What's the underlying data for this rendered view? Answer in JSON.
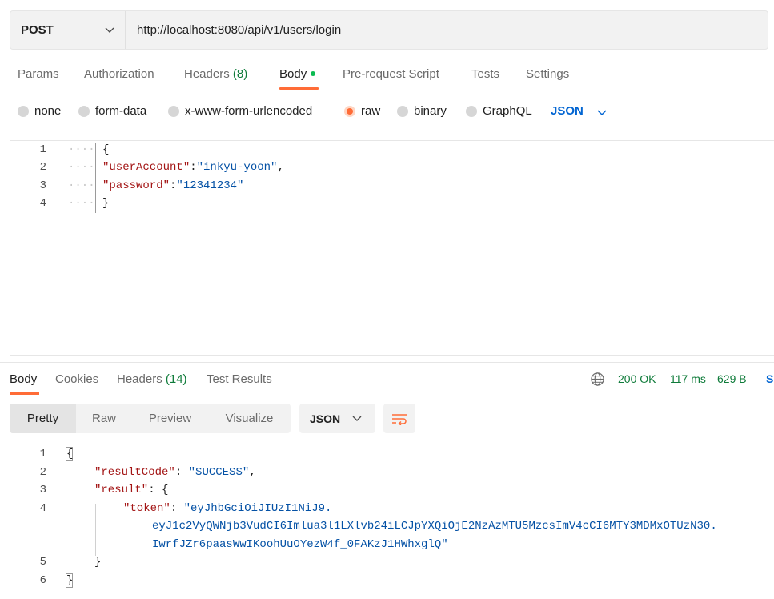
{
  "request": {
    "method": "POST",
    "url": "http://localhost:8080/api/v1/users/login"
  },
  "request_tabs": {
    "params": "Params",
    "authorization": "Authorization",
    "headers": "Headers",
    "headers_count": "(8)",
    "body": "Body",
    "prerequest": "Pre-request Script",
    "tests": "Tests",
    "settings": "Settings",
    "active": "Body"
  },
  "body_modes": {
    "none": "none",
    "form_data": "form-data",
    "urlencoded": "x-www-form-urlencoded",
    "raw": "raw",
    "binary": "binary",
    "graphql": "GraphQL",
    "selected": "raw",
    "language": "JSON"
  },
  "request_body": {
    "line_numbers": [
      "1",
      "2",
      "3",
      "4"
    ],
    "open_brace": "{",
    "close_brace": "}",
    "k1": "\"userAccount\"",
    "v1": "\"inkyu-yoon\"",
    "k2": "\"password\"",
    "v2": "\"12341234\"",
    "colon": ":",
    "comma": ","
  },
  "response_tabs": {
    "body": "Body",
    "cookies": "Cookies",
    "headers": "Headers",
    "headers_count": "(14)",
    "test_results": "Test Results",
    "active": "Body"
  },
  "response_meta": {
    "status": "200 OK",
    "time": "117 ms",
    "size": "629 B",
    "save_truncated": "S"
  },
  "response_toolbar": {
    "views": [
      "Pretty",
      "Raw",
      "Preview",
      "Visualize"
    ],
    "active_view": "Pretty",
    "format": "JSON"
  },
  "response_body": {
    "line_numbers": [
      "1",
      "2",
      "3",
      "4",
      "5",
      "6"
    ],
    "open_brace": "{",
    "close_brace": "}",
    "k_resultCode": "\"resultCode\"",
    "v_resultCode": "\"SUCCESS\"",
    "k_result": "\"result\"",
    "k_token": "\"token\"",
    "token_line1": "\"eyJhbGciOiJIUzI1NiJ9.",
    "token_line2": "eyJ1c2VyQWNjb3VudCI6Imlua3l1LXlvb24iLCJpYXQiOjE2NzAzMTU5MzcsImV4cCI6MTY3MDMxOTUzN30.",
    "token_line3": "IwrfJZr6paasWwIKoohUuOYezW4f_0FAKzJ1HWhxglQ\""
  },
  "colors": {
    "accent": "#ff6c37",
    "status_green": "#0f7b3a",
    "json_key": "#a31515",
    "json_string": "#0451a5",
    "link_blue": "#0265d2"
  },
  "icons": [
    "chevron-down-icon",
    "globe-icon",
    "wrap-lines-icon"
  ]
}
